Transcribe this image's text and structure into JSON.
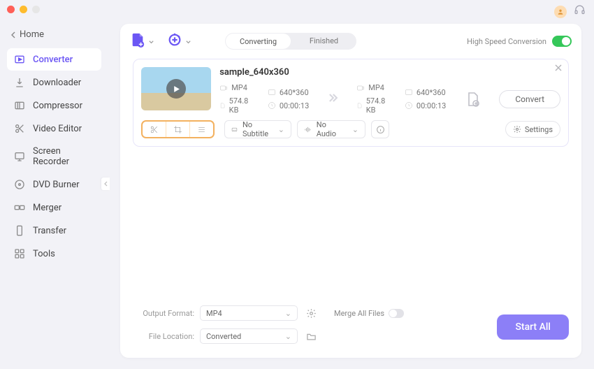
{
  "home_label": "Home",
  "sidebar": {
    "items": [
      {
        "label": "Converter"
      },
      {
        "label": "Downloader"
      },
      {
        "label": "Compressor"
      },
      {
        "label": "Video Editor"
      },
      {
        "label": "Screen Recorder"
      },
      {
        "label": "DVD Burner"
      },
      {
        "label": "Merger"
      },
      {
        "label": "Transfer"
      },
      {
        "label": "Tools"
      }
    ]
  },
  "tabs": {
    "converting": "Converting",
    "finished": "Finished"
  },
  "hs_label": "High Speed Conversion",
  "file": {
    "name": "sample_640x360",
    "in": {
      "format": "MP4",
      "res": "640*360",
      "size": "574.8 KB",
      "dur": "00:00:13"
    },
    "out": {
      "format": "MP4",
      "res": "640*360",
      "size": "574.8 KB",
      "dur": "00:00:13"
    },
    "subtitle_sel": "No Subtitle",
    "audio_sel": "No Audio",
    "settings_label": "Settings",
    "convert_label": "Convert"
  },
  "footer": {
    "output_format_label": "Output Format:",
    "output_format_value": "MP4",
    "file_location_label": "File Location:",
    "file_location_value": "Converted",
    "merge_label": "Merge All Files",
    "start_all_label": "Start All"
  }
}
